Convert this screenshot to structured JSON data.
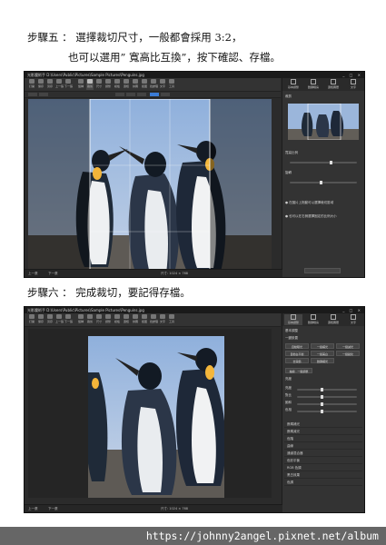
{
  "step5_line1": "步驟五 ： 選擇裁切尺寸，一般都會採用 3:2，",
  "step5_line2": "也可以選用” 寬高比互換”，按下確認、存檔。",
  "step6": "步驟六 ： 完成裁切，要記得存檔。",
  "app": {
    "title": "光影魔術手 D:\\Users\\Public\\Pictures\\Sample Pictures\\Penguins.jpg",
    "window_controls": "_ □ ×",
    "toolbar_items": [
      "打開",
      "保存",
      "另存",
      "上一張",
      "下一張",
      "旋轉",
      "裁剪",
      "尺寸",
      "調整",
      "模板",
      "邊框",
      "拼圖",
      "抠图",
      "批處理",
      "文字",
      "工具"
    ],
    "sidebar_tabs": [
      "基本調整",
      "數碼暗房",
      "邊框圖層",
      "文字",
      "水印"
    ],
    "panel1": {
      "header": "裁剪",
      "label_a": "寬高比例",
      "label_b": "旋轉",
      "note1": "● 在圖片上拖動可以選擇裁切區域",
      "note2": "● 也可以在右側選擇固定的比例大小",
      "status_left": "上一張",
      "status_mid": "下一張",
      "status_right": "尺寸: 1024 × 768"
    },
    "panel2": {
      "header": "基本調整",
      "section": "一鍵設置",
      "buttons": [
        "自動曝光",
        "一鍵補光",
        "一鍵減光",
        "自動白平衡",
        "一鍵美白",
        "一鍵鋭化",
        "去霧鏡",
        "數碼補光"
      ],
      "wide_button": "抽線 · 一鍵調整",
      "section2": "亮度",
      "sliders": [
        "亮度",
        "對比",
        "飽和",
        "色相"
      ],
      "menus": [
        "數碼補光",
        "數碼減光",
        "色階",
        "曲線",
        "通道混合器",
        "色彩平衡",
        "RGB 色調",
        "黑白效果",
        "色調"
      ],
      "status_left": "上一張",
      "status_mid": "下一張",
      "status_right": "尺寸: 1024 × 768"
    }
  },
  "footer_url": "https://johnny2angel.pixnet.net/album",
  "colors": {
    "accent": "#3a7bd5",
    "app_bg": "#2b2b2b",
    "footer_bg": "#666666"
  }
}
